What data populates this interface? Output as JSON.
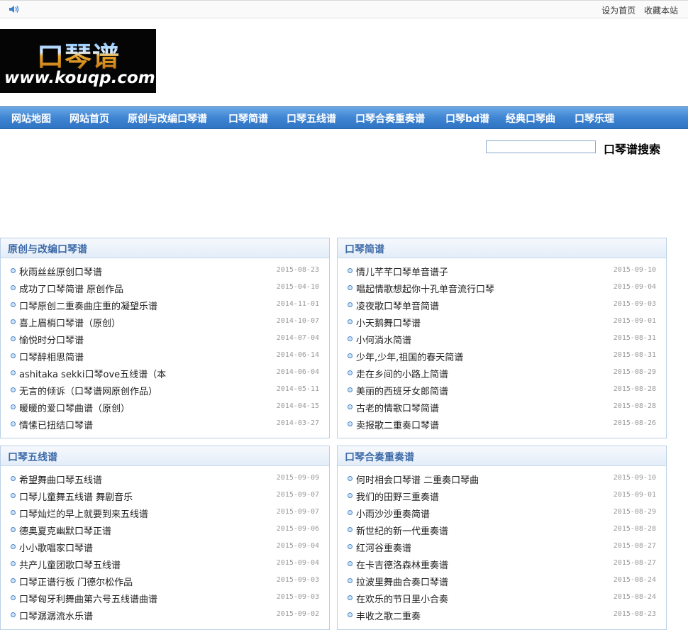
{
  "topbar": {
    "links": [
      "设为首页",
      "收藏本站"
    ],
    "icon": "speaker-icon"
  },
  "logo": {
    "cn": "口琴谱",
    "en": "www.kouqp.com"
  },
  "nav": [
    "网站地图",
    "网站首页",
    "原创与改编口琴谱",
    "口琴简谱",
    "口琴五线谱",
    "口琴合奏重奏谱",
    "口琴bd谱",
    "经典口琴曲",
    "口琴乐理"
  ],
  "search": {
    "label": "口琴谱搜索",
    "value": "",
    "placeholder": ""
  },
  "panels": [
    {
      "title": "原创与改编口琴谱",
      "items": [
        {
          "t": "秋雨丝丝原创口琴谱",
          "d": "2015-08-23"
        },
        {
          "t": "成功了口琴简谱 原创作品",
          "d": "2015-04-10"
        },
        {
          "t": "口琴原创二重奏曲庄重的凝望乐谱",
          "d": "2014-11-01"
        },
        {
          "t": "喜上眉梢口琴谱（原创）",
          "d": "2014-10-07"
        },
        {
          "t": "愉悦时分口琴谱",
          "d": "2014-07-04"
        },
        {
          "t": "口琴醉相思简谱",
          "d": "2014-06-14"
        },
        {
          "t": "ashitaka sekki口琴ove五线谱（本",
          "d": "2014-06-04"
        },
        {
          "t": "无言的倾诉（口琴谱网原创作品）",
          "d": "2014-05-11"
        },
        {
          "t": "暖暖的爱口琴曲谱（原创）",
          "d": "2014-04-15"
        },
        {
          "t": "情愫已扭结口琴谱",
          "d": "2014-03-27"
        }
      ]
    },
    {
      "title": "口琴简谱",
      "items": [
        {
          "t": "情儿芊芊口琴单音谱子",
          "d": "2015-09-10"
        },
        {
          "t": "唱起情歌想起你十孔单音流行口琴",
          "d": "2015-09-04"
        },
        {
          "t": "凌夜歌口琴单音简谱",
          "d": "2015-09-03"
        },
        {
          "t": "小天鹅舞口琴谱",
          "d": "2015-09-01"
        },
        {
          "t": "小何淌水简谱",
          "d": "2015-08-31"
        },
        {
          "t": "少年,少年,祖国的春天简谱",
          "d": "2015-08-31"
        },
        {
          "t": "走在乡间的小路上简谱",
          "d": "2015-08-29"
        },
        {
          "t": "美丽的西班牙女郎简谱",
          "d": "2015-08-28"
        },
        {
          "t": "古老的情歌口琴简谱",
          "d": "2015-08-28"
        },
        {
          "t": "卖报歌二重奏口琴谱",
          "d": "2015-08-26"
        }
      ]
    },
    {
      "title": "口琴五线谱",
      "items": [
        {
          "t": "希望舞曲口琴五线谱",
          "d": "2015-09-09"
        },
        {
          "t": "口琴儿童舞五线谱 舞剧音乐",
          "d": "2015-09-07"
        },
        {
          "t": "口琴灿烂的早上就要到来五线谱",
          "d": "2015-09-07"
        },
        {
          "t": "德奥夏克幽默口琴正谱",
          "d": "2015-09-06"
        },
        {
          "t": "小小歌唱家口琴谱",
          "d": "2015-09-04"
        },
        {
          "t": "共产儿童团歌口琴五线谱",
          "d": "2015-09-04"
        },
        {
          "t": "口琴正谱行板 门德尔松作品",
          "d": "2015-09-03"
        },
        {
          "t": "口琴匈牙利舞曲第六号五线谱曲谱",
          "d": "2015-09-03"
        },
        {
          "t": "口琴潺潺流水乐谱",
          "d": "2015-09-02"
        }
      ]
    },
    {
      "title": "口琴合奏重奏谱",
      "items": [
        {
          "t": "何时相会口琴谱 二重奏口琴曲",
          "d": "2015-09-10"
        },
        {
          "t": "我们的田野三重奏谱",
          "d": "2015-09-01"
        },
        {
          "t": "小雨沙沙重奏简谱",
          "d": "2015-08-29"
        },
        {
          "t": "新世纪的新一代重奏谱",
          "d": "2015-08-28"
        },
        {
          "t": "红河谷重奏谱",
          "d": "2015-08-27"
        },
        {
          "t": "在卡吉德洛森林重奏谱",
          "d": "2015-08-27"
        },
        {
          "t": "拉波里舞曲合奏口琴谱",
          "d": "2015-08-24"
        },
        {
          "t": "在欢乐的节日里小合奏",
          "d": "2015-08-24"
        },
        {
          "t": "丰收之歌二重奏",
          "d": "2015-08-23"
        }
      ]
    }
  ]
}
